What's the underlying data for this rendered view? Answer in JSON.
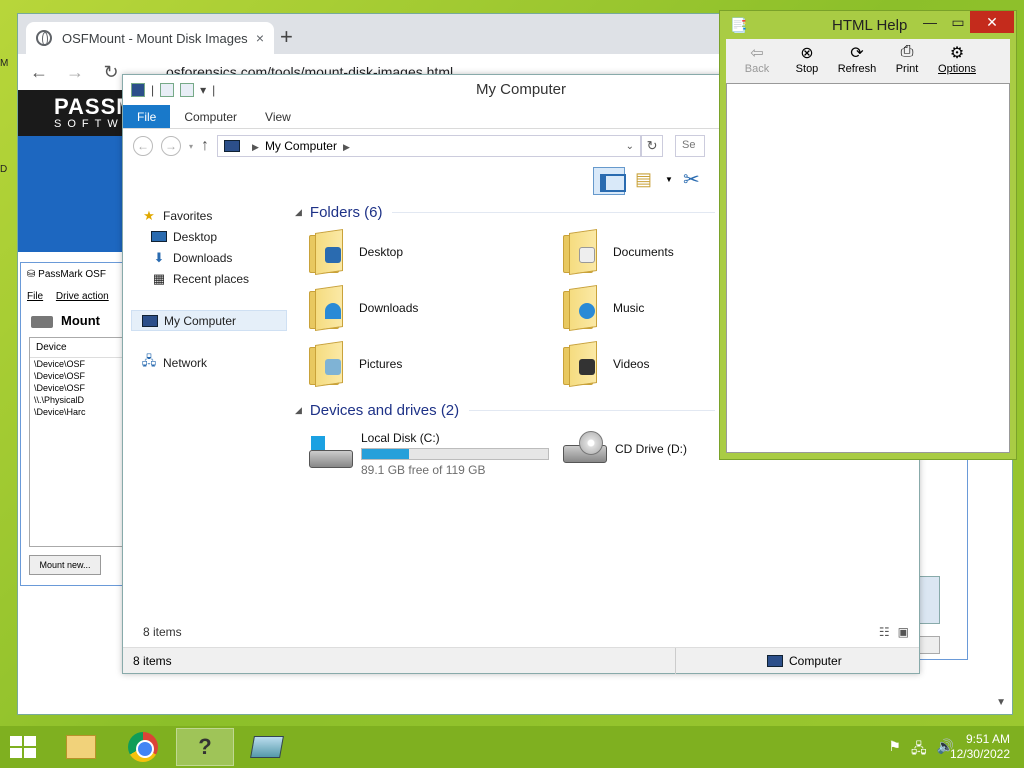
{
  "chrome": {
    "tab_title": "OSFMount - Mount Disk Images",
    "tab_close": "×",
    "new_tab": "+",
    "url": "osforensics.com/tools/mount-disk-images.html"
  },
  "website": {
    "brand_line1": "PASSM",
    "brand_line2": "SOFTW"
  },
  "osfmount": {
    "title": "PassMark OSF",
    "menu": [
      "File",
      "Drive action"
    ],
    "heading": "Mount",
    "column": "Device",
    "rows": [
      "\\Device\\OSF",
      "\\Device\\OSF",
      "\\Device\\OSF",
      "\\\\.\\PhysicalD",
      "\\Device\\Harc"
    ],
    "mount_button": "Mount new..."
  },
  "explorer": {
    "title": "My Computer",
    "ribbon_tabs": [
      "File",
      "Computer",
      "View"
    ],
    "breadcrumb": "My Computer",
    "search_placeholder": "Se",
    "nav": {
      "favorites": "Favorites",
      "desktop": "Desktop",
      "downloads": "Downloads",
      "recent": "Recent places",
      "my_computer": "My Computer",
      "network": "Network"
    },
    "folders_header": "Folders (6)",
    "folders": [
      "Desktop",
      "Documents",
      "Downloads",
      "Music",
      "Pictures",
      "Videos"
    ],
    "devices_header": "Devices and drives (2)",
    "local_disk": {
      "name": "Local Disk (C:)",
      "free": "89.1 GB free of 119 GB",
      "used_fraction": 0.25
    },
    "cd_drive": "CD Drive (D:)",
    "items_count": "8 items",
    "status_left": "8 items",
    "status_right": "Computer"
  },
  "help": {
    "title": "HTML Help",
    "buttons": [
      "Back",
      "Stop",
      "Refresh",
      "Print",
      "Options"
    ]
  },
  "taskbar": {
    "time": "9:51 AM",
    "date": "12/30/2022"
  }
}
